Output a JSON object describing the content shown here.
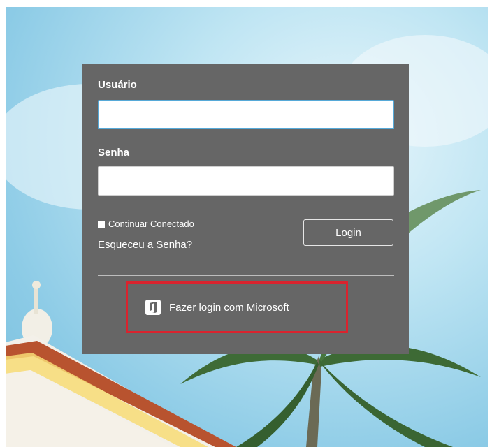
{
  "form": {
    "username_label": "Usuário",
    "username_value": "",
    "password_label": "Senha",
    "password_value": "",
    "remember_label": "Continuar Conectado",
    "forgot_label": "Esqueceu a Senha?",
    "login_label": "Login",
    "microsoft_label": "Fazer login com Microsoft"
  },
  "colors": {
    "panel": "#666666",
    "focus_border": "#56a9d8",
    "highlight": "#d9232e"
  },
  "icons": {
    "microsoft": "office-icon"
  }
}
